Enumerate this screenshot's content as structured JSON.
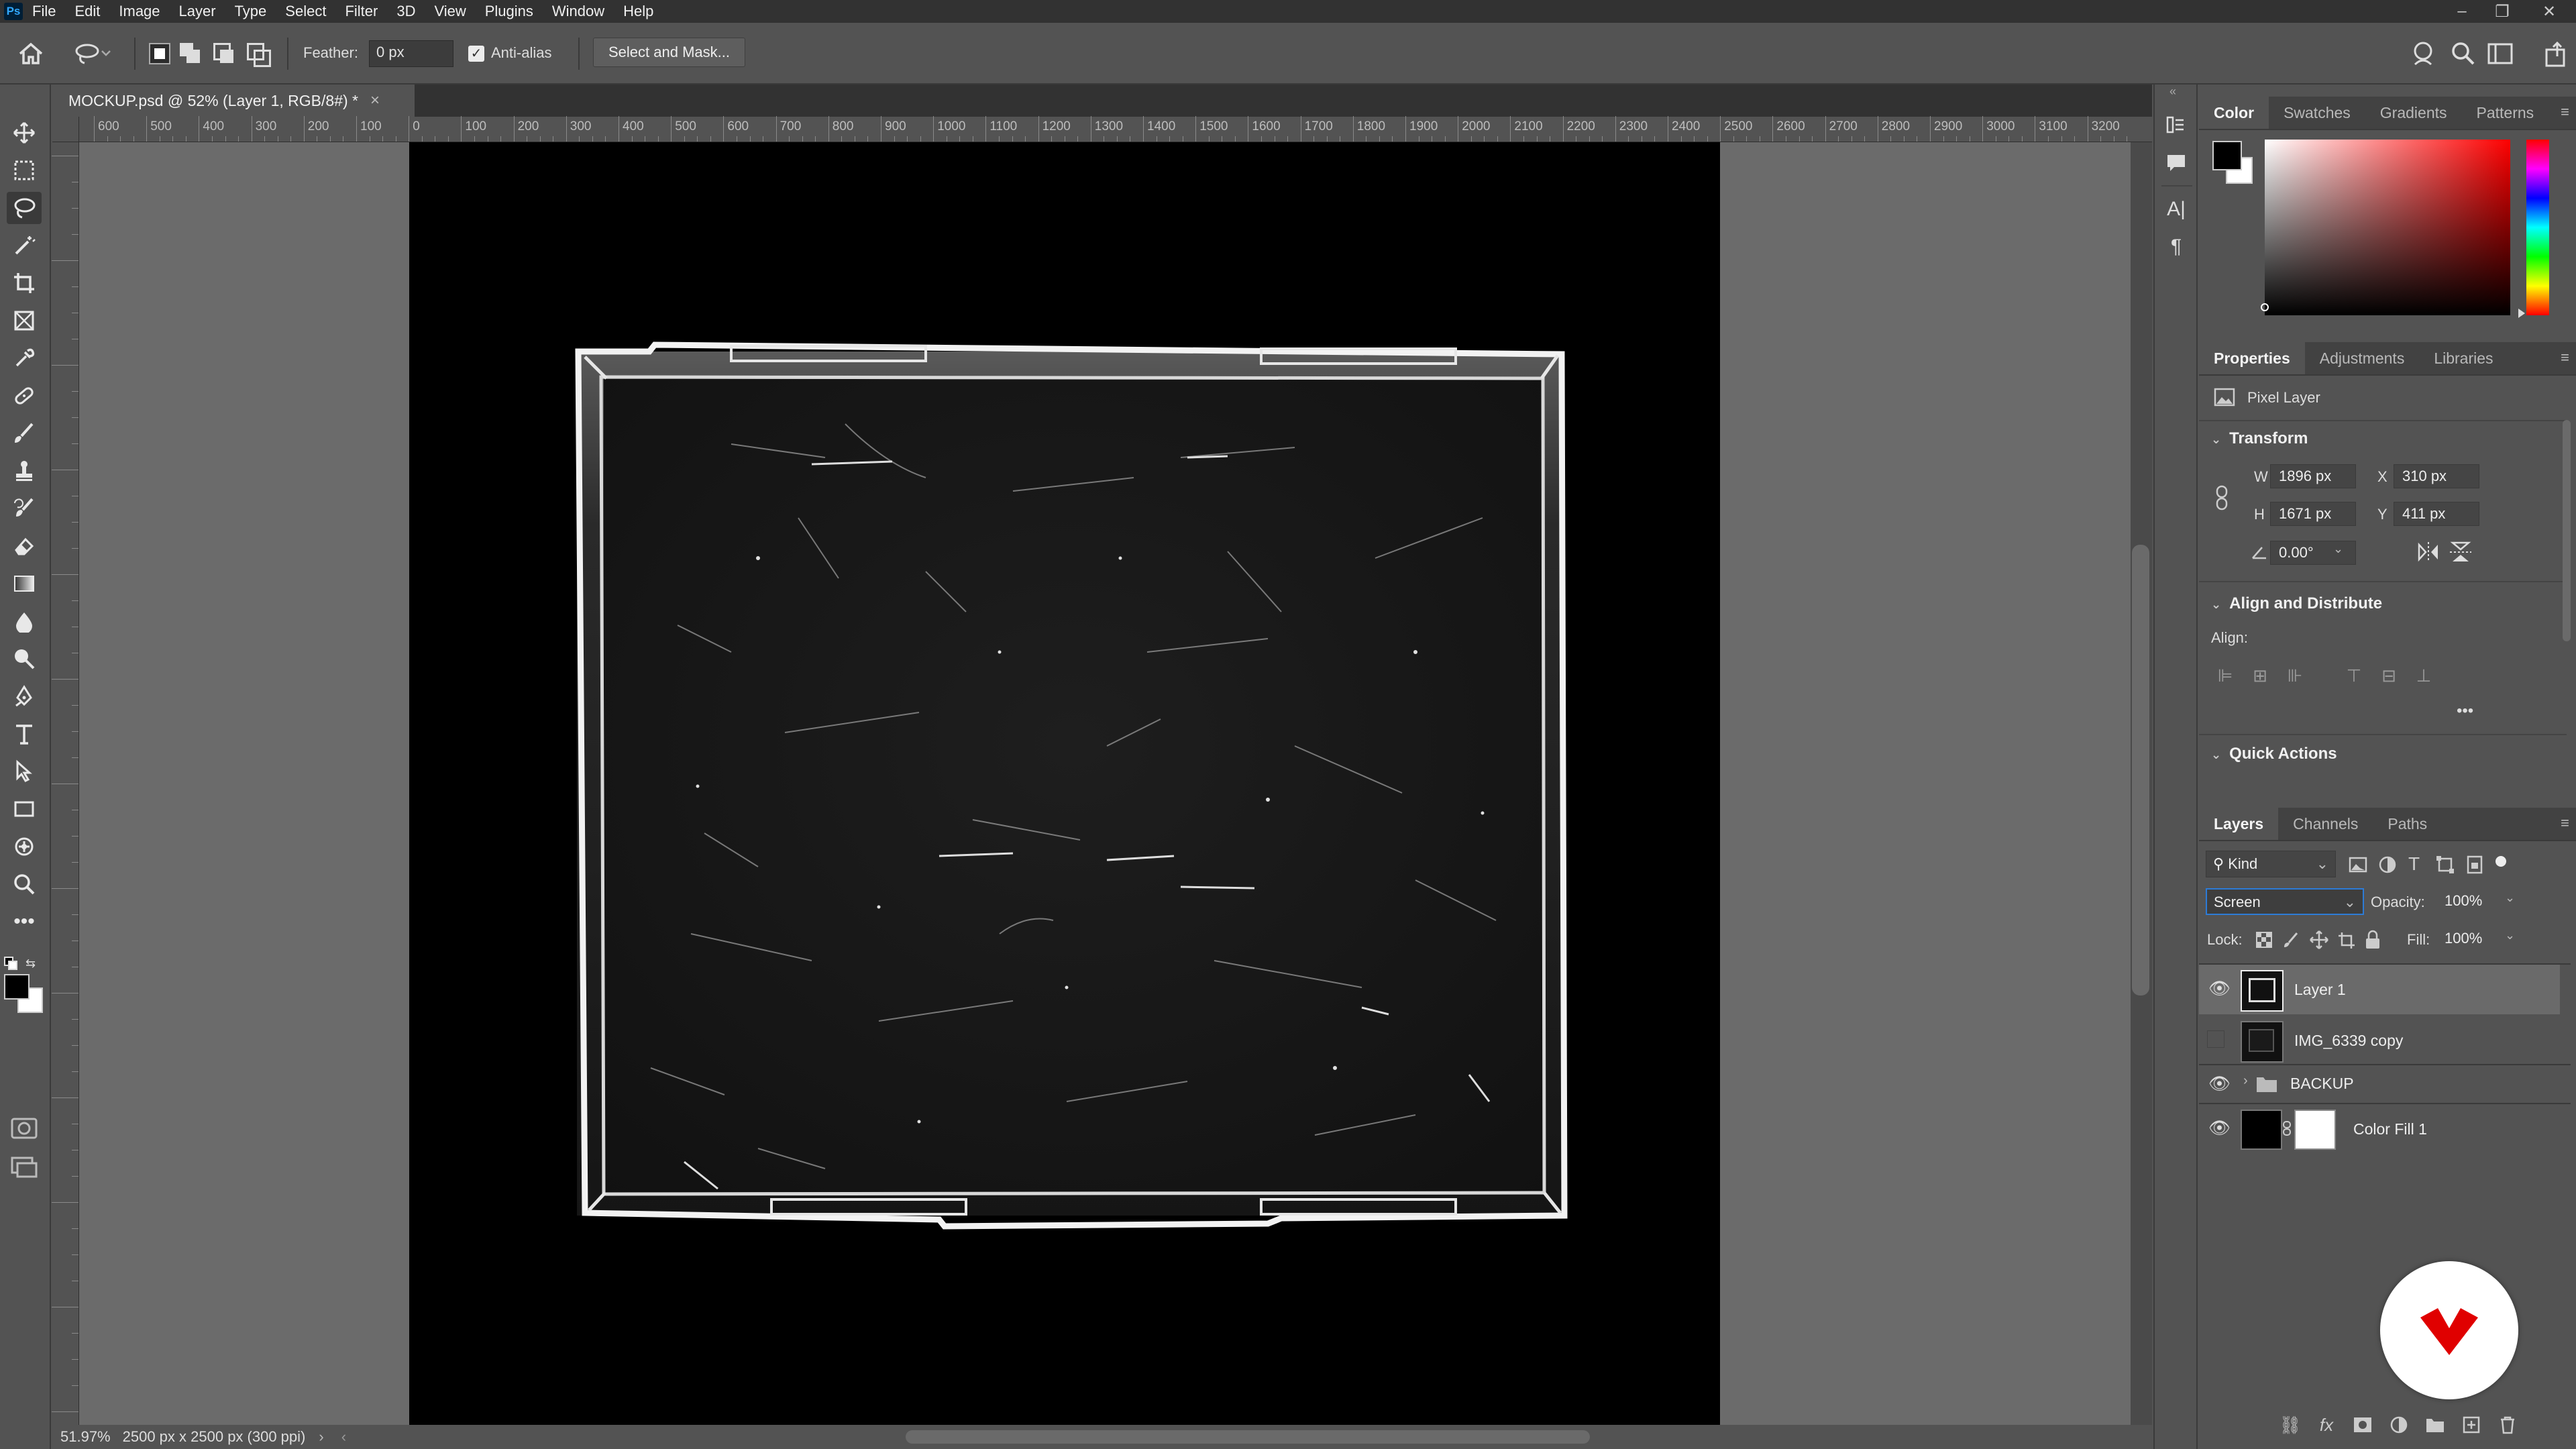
{
  "menubar": {
    "logo": "Ps",
    "items": [
      "File",
      "Edit",
      "Image",
      "Layer",
      "Type",
      "Select",
      "Filter",
      "3D",
      "View",
      "Plugins",
      "Window",
      "Help"
    ],
    "minimize": "–",
    "restore": "❐",
    "close": "✕"
  },
  "options": {
    "feather_label": "Feather:",
    "feather_value": "0 px",
    "antialias_label": "Anti-alias",
    "select_mask": "Select and Mask..."
  },
  "document": {
    "tab_title": "MOCKUP.psd @ 52% (Layer 1, RGB/8#) *",
    "tab_close": "×",
    "zoom": "51.97%",
    "doc_info": "2500 px x 2500 px (300 ppi)"
  },
  "ruler_labels": [
    "600",
    "500",
    "400",
    "300",
    "200",
    "100",
    "0",
    "100",
    "200",
    "300",
    "400",
    "500",
    "600",
    "700",
    "800",
    "900",
    "1000",
    "1100",
    "1200",
    "1300",
    "1400",
    "1500",
    "1600",
    "1700",
    "1800",
    "1900",
    "2000",
    "2100",
    "2200",
    "2300",
    "2400",
    "2500",
    "2600",
    "2700",
    "2800",
    "2900",
    "3000",
    "3100",
    "3200"
  ],
  "color_panel": {
    "tabs": [
      "Color",
      "Swatches",
      "Gradients",
      "Patterns"
    ],
    "active": "Color",
    "foreground": "#000000",
    "background": "#ffffff",
    "hue": "#ff0000"
  },
  "properties_panel": {
    "tabs": [
      "Properties",
      "Adjustments",
      "Libraries"
    ],
    "active": "Properties",
    "layer_type": "Pixel Layer",
    "transform_header": "Transform",
    "w_label": "W",
    "w_value": "1896 px",
    "h_label": "H",
    "h_value": "1671 px",
    "x_label": "X",
    "x_value": "310 px",
    "y_label": "Y",
    "y_value": "411 px",
    "angle_value": "0.00°",
    "align_header": "Align and Distribute",
    "align_label": "Align:",
    "more": "•••",
    "quick_actions_header": "Quick Actions"
  },
  "layers_panel": {
    "tabs": [
      "Layers",
      "Channels",
      "Paths"
    ],
    "active": "Layers",
    "kind_label": "Kind",
    "blend_mode": "Screen",
    "opacity_label": "Opacity:",
    "opacity_value": "100%",
    "lock_label": "Lock:",
    "fill_label": "Fill:",
    "fill_value": "100%",
    "layers": [
      {
        "name": "Layer 1",
        "visible": true,
        "selected": true
      },
      {
        "name": "IMG_6339 copy",
        "visible": false,
        "selected": false
      },
      {
        "name": "BACKUP",
        "visible": true,
        "selected": false
      },
      {
        "name": "Color Fill 1",
        "visible": true,
        "selected": false
      }
    ]
  },
  "colors": {
    "accent": "#e00000"
  }
}
